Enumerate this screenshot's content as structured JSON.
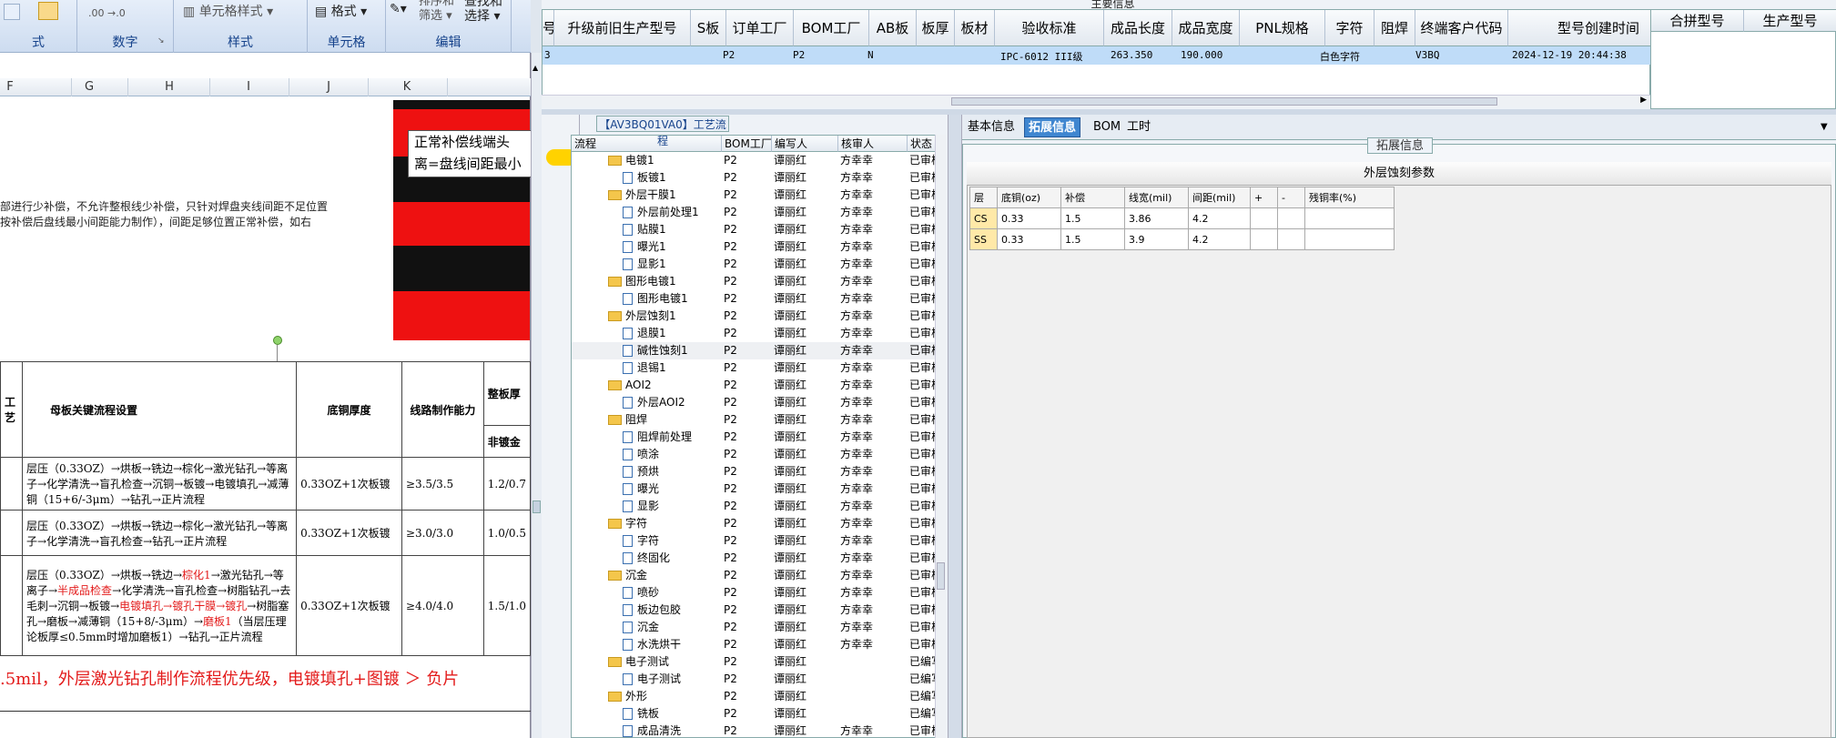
{
  "excel": {
    "ribbon": {
      "groups": [
        {
          "label": "式"
        },
        {
          "label": "数字"
        },
        {
          "label": "样式"
        },
        {
          "label": "单元格"
        },
        {
          "label": "编辑"
        }
      ],
      "cell_style_button": "单元格样式",
      "format_button": "格式",
      "sort_filter_button_line1": "排序和",
      "sort_filter_button_line2": "筛选",
      "find_select_button_line1": "查找和",
      "find_select_button_line2": "选择"
    },
    "columns": [
      "F",
      "G",
      "H",
      "I",
      "J",
      "K"
    ],
    "note_lines": [
      "部进行少补偿，不允许整根线少补偿，只针对焊盘夹线间距不足位置",
      "按补偿后盘线最小间距能力制作），间距足够位置正常补偿，如右"
    ],
    "callout_lines": [
      "正常补偿线端头",
      "离=盘线间距最小"
    ],
    "table": {
      "header": [
        "工艺",
        "母板关键流程设置",
        "底铜厚度",
        "线路制作能力",
        "整板厚",
        "非镀金"
      ],
      "rows": [
        {
          "flow": "层压（0.33OZ）→烘板→铣边→棕化→激光钻孔→等离子→化学清洗→盲孔检查→沉铜→板镀→电镀填孔→减薄铜（15+6/-3μm）→钻孔→正片流程",
          "copper": "0.33OZ+1次板镀",
          "cap": "≥3.5/3.5",
          "thick": "1.2/0.7"
        },
        {
          "flow": "层压（0.33OZ）→烘板→铣边→棕化→激光钻孔→等离子→化学清洗→盲孔检查→钻孔→正片流程",
          "copper": "0.33OZ+1次板镀",
          "cap": "≥3.0/3.0",
          "thick": "1.0/0.5"
        },
        {
          "flow_a": "层压（0.33OZ）→烘板→铣边→",
          "flow_b": "棕化1",
          "flow_c": "→激光钻孔→等离子→",
          "flow_d": "半成品检查",
          "flow_e": "→化学清洗→盲孔检查→树脂钻孔→去毛刺→沉铜→板镀→",
          "flow_f": "电镀填孔→镀孔干膜→镀孔",
          "flow_g": "→树脂塞孔→磨板→减薄铜（15+8/-3μm）→",
          "flow_h": "磨板1",
          "flow_i": "（当层压理论板厚≤0.5mm时增加磨板1）→钻孔→正片流程",
          "copper": "0.33OZ+1次板镀",
          "cap": "≥4.0/4.0",
          "thick": "1.5/1.0"
        }
      ]
    },
    "red_note": ".5mil，外层激光钻孔制作流程优先级，电镀填孔+图镀 ＞ 负片"
  },
  "main_info": {
    "section_label": "主要信息",
    "columns": [
      "号",
      "升级前旧生产型号",
      "S板",
      "订单工厂",
      "BOM工厂",
      "AB板",
      "板厚",
      "板材",
      "验收标准",
      "成品长度",
      "成品宽度",
      "PNL规格",
      "字符",
      "阻焊",
      "终端客户代码",
      "型号创建时间"
    ],
    "row": {
      "c0": "3",
      "order_factory": "P2",
      "bom_factory": "P2",
      "ab": "N",
      "standard": "IPC-6012 III级",
      "length": "263.350",
      "width": "190.000",
      "char": "白色字符",
      "customer": "V3BQ",
      "created": "2024-12-19 20:44:38"
    },
    "right_columns": [
      "合拼型号",
      "生产型号"
    ]
  },
  "process_tree": {
    "title": "【AV3BQ01VA0】工艺流程",
    "columns": [
      "流程",
      "BOM工厂",
      "编写人",
      "核审人",
      "状态"
    ],
    "rows": [
      {
        "name": "电镀1",
        "type": "folder",
        "bom": "P2",
        "writer": "谭丽红",
        "reviewer": "方幸幸",
        "status": "已审核"
      },
      {
        "name": "板镀1",
        "type": "file",
        "bom": "P2",
        "writer": "谭丽红",
        "reviewer": "方幸幸",
        "status": "已审核"
      },
      {
        "name": "外层干膜1",
        "type": "folder",
        "bom": "P2",
        "writer": "谭丽红",
        "reviewer": "方幸幸",
        "status": "已审核"
      },
      {
        "name": "外层前处理1",
        "type": "file",
        "bom": "P2",
        "writer": "谭丽红",
        "reviewer": "方幸幸",
        "status": "已审核"
      },
      {
        "name": "贴膜1",
        "type": "file",
        "bom": "P2",
        "writer": "谭丽红",
        "reviewer": "方幸幸",
        "status": "已审核"
      },
      {
        "name": "曝光1",
        "type": "file",
        "bom": "P2",
        "writer": "谭丽红",
        "reviewer": "方幸幸",
        "status": "已审核"
      },
      {
        "name": "显影1",
        "type": "file",
        "bom": "P2",
        "writer": "谭丽红",
        "reviewer": "方幸幸",
        "status": "已审核"
      },
      {
        "name": "图形电镀1",
        "type": "folder",
        "bom": "P2",
        "writer": "谭丽红",
        "reviewer": "方幸幸",
        "status": "已审核"
      },
      {
        "name": "图形电镀1",
        "type": "file",
        "bom": "P2",
        "writer": "谭丽红",
        "reviewer": "方幸幸",
        "status": "已审核"
      },
      {
        "name": "外层蚀刻1",
        "type": "folder",
        "bom": "P2",
        "writer": "谭丽红",
        "reviewer": "方幸幸",
        "status": "已审核"
      },
      {
        "name": "退膜1",
        "type": "file",
        "bom": "P2",
        "writer": "谭丽红",
        "reviewer": "方幸幸",
        "status": "已审核"
      },
      {
        "name": "碱性蚀刻1",
        "type": "file",
        "bom": "P2",
        "writer": "谭丽红",
        "reviewer": "方幸幸",
        "status": "已审核"
      },
      {
        "name": "退锡1",
        "type": "file",
        "bom": "P2",
        "writer": "谭丽红",
        "reviewer": "方幸幸",
        "status": "已审核"
      },
      {
        "name": "AOI2",
        "type": "folder",
        "bom": "P2",
        "writer": "谭丽红",
        "reviewer": "方幸幸",
        "status": "已审核"
      },
      {
        "name": "外层AOI2",
        "type": "file",
        "bom": "P2",
        "writer": "谭丽红",
        "reviewer": "方幸幸",
        "status": "已审核"
      },
      {
        "name": "阻焊",
        "type": "folder",
        "bom": "P2",
        "writer": "谭丽红",
        "reviewer": "方幸幸",
        "status": "已审核"
      },
      {
        "name": "阻焊前处理",
        "type": "file",
        "bom": "P2",
        "writer": "谭丽红",
        "reviewer": "方幸幸",
        "status": "已审核"
      },
      {
        "name": "喷涂",
        "type": "file",
        "bom": "P2",
        "writer": "谭丽红",
        "reviewer": "方幸幸",
        "status": "已审核"
      },
      {
        "name": "预烘",
        "type": "file",
        "bom": "P2",
        "writer": "谭丽红",
        "reviewer": "方幸幸",
        "status": "已审核"
      },
      {
        "name": "曝光",
        "type": "file",
        "bom": "P2",
        "writer": "谭丽红",
        "reviewer": "方幸幸",
        "status": "已审核"
      },
      {
        "name": "显影",
        "type": "file",
        "bom": "P2",
        "writer": "谭丽红",
        "reviewer": "方幸幸",
        "status": "已审核"
      },
      {
        "name": "字符",
        "type": "folder",
        "bom": "P2",
        "writer": "谭丽红",
        "reviewer": "方幸幸",
        "status": "已审核"
      },
      {
        "name": "字符",
        "type": "file",
        "bom": "P2",
        "writer": "谭丽红",
        "reviewer": "方幸幸",
        "status": "已审核"
      },
      {
        "name": "终固化",
        "type": "file",
        "bom": "P2",
        "writer": "谭丽红",
        "reviewer": "方幸幸",
        "status": "已审核"
      },
      {
        "name": "沉金",
        "type": "folder",
        "bom": "P2",
        "writer": "谭丽红",
        "reviewer": "方幸幸",
        "status": "已审核"
      },
      {
        "name": "喷砂",
        "type": "file",
        "bom": "P2",
        "writer": "谭丽红",
        "reviewer": "方幸幸",
        "status": "已审核"
      },
      {
        "name": "板边包胶",
        "type": "file",
        "bom": "P2",
        "writer": "谭丽红",
        "reviewer": "方幸幸",
        "status": "已审核"
      },
      {
        "name": "沉金",
        "type": "file",
        "bom": "P2",
        "writer": "谭丽红",
        "reviewer": "方幸幸",
        "status": "已审核"
      },
      {
        "name": "水洗烘干",
        "type": "file",
        "bom": "P2",
        "writer": "谭丽红",
        "reviewer": "方幸幸",
        "status": "已审核"
      },
      {
        "name": "电子测试",
        "type": "folder",
        "bom": "P2",
        "writer": "谭丽红",
        "reviewer": "",
        "status": "已编写"
      },
      {
        "name": "电子测试",
        "type": "file",
        "bom": "P2",
        "writer": "谭丽红",
        "reviewer": "",
        "status": "已编写"
      },
      {
        "name": "外形",
        "type": "folder",
        "bom": "P2",
        "writer": "谭丽红",
        "reviewer": "",
        "status": "已编写"
      },
      {
        "name": "铣板",
        "type": "file",
        "bom": "P2",
        "writer": "谭丽红",
        "reviewer": "",
        "status": "已编写"
      },
      {
        "name": "成品清洗",
        "type": "file",
        "bom": "P2",
        "writer": "谭丽红",
        "reviewer": "方幸幸",
        "status": "已审核"
      }
    ]
  },
  "detail_tabs": [
    "基本信息",
    "拓展信息",
    "BOM",
    "工时"
  ],
  "active_tab": "拓展信息",
  "ext_info": {
    "frame_title": "拓展信息",
    "section_title": "外层蚀刻参数",
    "columns": [
      "层",
      "底铜(oz)",
      "补偿",
      "线宽(mil)",
      "间距(mil)",
      "+",
      "-",
      "残铜率(%)"
    ],
    "rows": [
      [
        "CS",
        "0.33",
        "1.5",
        "3.86",
        "4.2",
        "",
        "",
        ""
      ],
      [
        "SS",
        "0.33",
        "1.5",
        "3.9",
        "4.2",
        "",
        "",
        ""
      ]
    ]
  },
  "colors": {
    "selection": "#bfdcf8",
    "active_tab": "#3f86d0",
    "red": "#ee1111"
  }
}
